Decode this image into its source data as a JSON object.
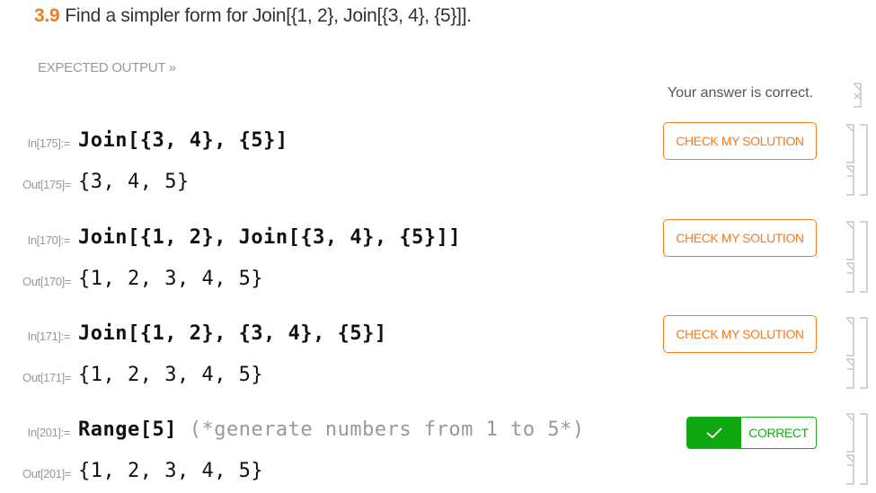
{
  "exercise": {
    "number": "3.9",
    "prompt": "Find a simpler form for Join[{1, 2}, Join[{3, 4}, {5}]].",
    "expected_output_link": "EXPECTED OUTPUT »",
    "status_message": "Your answer is correct."
  },
  "colors": {
    "accent_orange": "#f47b20",
    "correct_green": "#10a810",
    "label_gray": "#999999"
  },
  "cells": [
    {
      "in_label": "In[175]:=",
      "input": "Join[{3, 4}, {5}]",
      "comment": "",
      "out_label": "Out[175]=",
      "output": "{3, 4, 5}",
      "button": {
        "type": "check",
        "label": "CHECK MY SOLUTION"
      }
    },
    {
      "in_label": "In[170]:=",
      "input": "Join[{1, 2}, Join[{3, 4}, {5}]]",
      "comment": "",
      "out_label": "Out[170]=",
      "output": "{1, 2, 3, 4, 5}",
      "button": {
        "type": "check",
        "label": "CHECK MY SOLUTION"
      }
    },
    {
      "in_label": "In[171]:=",
      "input": "Join[{1, 2}, {3, 4}, {5}]",
      "comment": "",
      "out_label": "Out[171]=",
      "output": "{1, 2, 3, 4, 5}",
      "button": {
        "type": "check",
        "label": "CHECK MY SOLUTION"
      }
    },
    {
      "in_label": "In[201]:=",
      "input": "Range[5] ",
      "comment": "(*generate numbers from 1 to 5*)",
      "out_label": "Out[201]=",
      "output": "{1, 2, 3, 4, 5}",
      "button": {
        "type": "correct",
        "label": "CORRECT",
        "icon": "checkmark-icon"
      }
    }
  ]
}
